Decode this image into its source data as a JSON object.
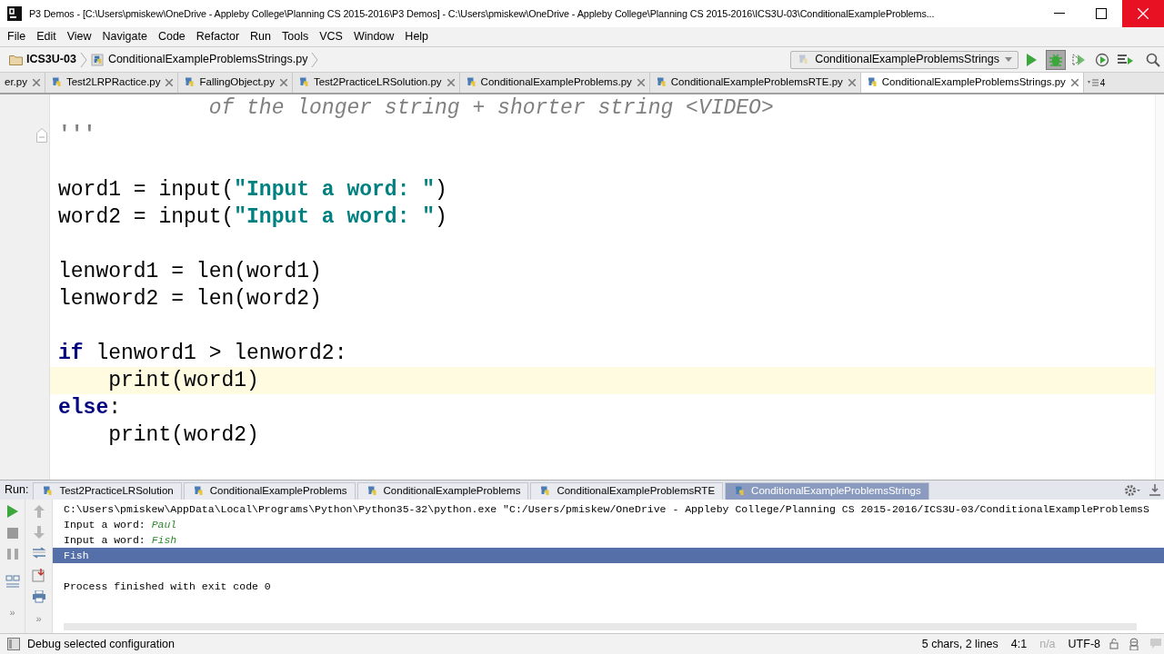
{
  "window": {
    "title": "P3 Demos - [C:\\Users\\pmiskew\\OneDrive - Appleby College\\Planning CS 2015-2016\\P3 Demos] - C:\\Users\\pmiskew\\OneDrive - Appleby College\\Planning CS 2015-2016\\ICS3U-03\\ConditionalExampleProblems..."
  },
  "menu": [
    "File",
    "Edit",
    "View",
    "Navigate",
    "Code",
    "Refactor",
    "Run",
    "Tools",
    "VCS",
    "Window",
    "Help"
  ],
  "breadcrumb": {
    "project": "ICS3U-03",
    "file": "ConditionalExampleProblemsStrings.py"
  },
  "run_config": "ConditionalExampleProblemsStrings",
  "editor_tabs": [
    {
      "label": "er.py",
      "selected": false
    },
    {
      "label": "Test2LRPRactice.py",
      "selected": false
    },
    {
      "label": "FallingObject.py",
      "selected": false
    },
    {
      "label": "Test2PracticeLRSolution.py",
      "selected": false
    },
    {
      "label": "ConditionalExampleProblems.py",
      "selected": false
    },
    {
      "label": "ConditionalExampleProblemsRTE.py",
      "selected": false
    },
    {
      "label": "ConditionalExampleProblemsStrings.py",
      "selected": true
    }
  ],
  "tab_overflow": "4",
  "code_lines": [
    {
      "current": false,
      "fold": false,
      "tokens": [
        {
          "kind": "comment",
          "text": "            of the longer string + shorter string <VIDEO>"
        }
      ]
    },
    {
      "current": false,
      "fold": true,
      "tokens": [
        {
          "kind": "docstring",
          "text": "'''"
        }
      ]
    },
    {
      "current": false,
      "fold": false
    },
    {
      "current": false,
      "fold": false,
      "tokens": [
        {
          "kind": "plain",
          "text": "word1 = input("
        },
        {
          "kind": "string",
          "text": "\"Input a word: \""
        },
        {
          "kind": "plain",
          "text": ")"
        }
      ]
    },
    {
      "current": false,
      "fold": false,
      "tokens": [
        {
          "kind": "plain",
          "text": "word2 = input("
        },
        {
          "kind": "string",
          "text": "\"Input a word: \""
        },
        {
          "kind": "plain",
          "text": ")"
        }
      ]
    },
    {
      "current": false,
      "fold": false
    },
    {
      "current": false,
      "fold": false,
      "tokens": [
        {
          "kind": "plain",
          "text": "lenword1 = len(word1)"
        }
      ]
    },
    {
      "current": false,
      "fold": false,
      "tokens": [
        {
          "kind": "plain",
          "text": "lenword2 = len(word2)"
        }
      ]
    },
    {
      "current": false,
      "fold": false
    },
    {
      "current": false,
      "fold": false,
      "tokens": [
        {
          "kind": "keyword",
          "text": "if"
        },
        {
          "kind": "plain",
          "text": " lenword1 > lenword2:"
        }
      ]
    },
    {
      "current": true,
      "fold": false,
      "tokens": [
        {
          "kind": "plain",
          "text": "    print(word1)"
        }
      ]
    },
    {
      "current": false,
      "fold": false,
      "tokens": [
        {
          "kind": "keyword",
          "text": "else"
        },
        {
          "kind": "plain",
          "text": ":"
        }
      ]
    },
    {
      "current": false,
      "fold": false,
      "tokens": [
        {
          "kind": "plain",
          "text": "    print(word2)"
        }
      ]
    }
  ],
  "run_panel": {
    "label": "Run:",
    "toolbar_more": [
      "»",
      "»"
    ],
    "tabs": [
      {
        "label": "Test2PracticeLRSolution",
        "selected": false
      },
      {
        "label": "ConditionalExampleProblems",
        "selected": false
      },
      {
        "label": "ConditionalExampleProblems",
        "selected": false
      },
      {
        "label": "ConditionalExampleProblemsRTE",
        "selected": false
      },
      {
        "label": "ConditionalExampleProblemsStrings",
        "selected": true
      }
    ],
    "console": [
      {
        "selected": false,
        "tokens": [
          {
            "kind": "output",
            "text": "C:\\Users\\pmiskew\\AppData\\Local\\Programs\\Python\\Python35-32\\python.exe \"C:/Users/pmiskew/OneDrive - Appleby College/Planning CS 2015-2016/ICS3U-03/ConditionalExampleProblemsS"
          }
        ]
      },
      {
        "selected": false,
        "tokens": [
          {
            "kind": "output",
            "text": "Input a word: "
          },
          {
            "kind": "input",
            "text": "Paul"
          }
        ]
      },
      {
        "selected": false,
        "tokens": [
          {
            "kind": "output",
            "text": "Input a word: "
          },
          {
            "kind": "input",
            "text": "Fish"
          }
        ]
      },
      {
        "selected": true,
        "tokens": [
          {
            "kind": "output",
            "text": "Fish"
          }
        ]
      },
      {
        "selected": false
      },
      {
        "selected": false,
        "tokens": [
          {
            "kind": "output",
            "text": "Process finished with exit code 0"
          }
        ]
      }
    ]
  },
  "status_bar": {
    "message": "Debug selected configuration",
    "items": [
      {
        "text": "5 chars, 2 lines",
        "disabled": false
      },
      {
        "text": "4:1",
        "disabled": false
      },
      {
        "text": "n/a",
        "disabled": true
      },
      {
        "text": "UTF-8",
        "disabled": false
      }
    ]
  }
}
